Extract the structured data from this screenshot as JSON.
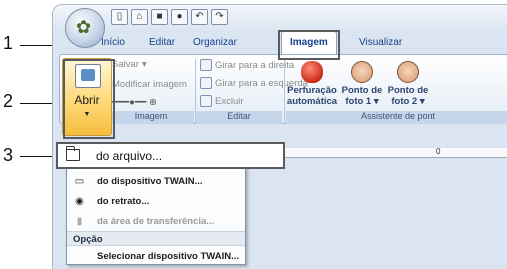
{
  "callouts": [
    "1",
    "2",
    "3"
  ],
  "quick_access": [
    "new-doc-icon",
    "open-icon",
    "save-icon",
    "record-icon",
    "undo-icon",
    "redo-icon"
  ],
  "tabs": {
    "inicio": "Início",
    "editar": "Editar",
    "organizar": "Organizar",
    "imagem": "Imagem",
    "visualizar": "Visualizar"
  },
  "ribbon": {
    "abrir": "Abrir",
    "salvar": "Salvar",
    "modificar_imagem": "Modificar imagem",
    "girar_direita": "Girar para a direita",
    "girar_esquerda": "Girar para a esquerda",
    "excluir": "Excluir",
    "group_imagem": "Imagem",
    "group_editar": "Editar",
    "perfuracao": "Perfuração",
    "automatica": "automática",
    "ponto_de_1": "Ponto de",
    "foto1": "foto 1",
    "ponto_de_2": "Ponto de",
    "foto2": "foto 2",
    "group_assistente": "Assistente de pont"
  },
  "ruler": {
    "zero": "0"
  },
  "menu": {
    "do_arquivo": "do arquivo...",
    "twain": "do dispositivo TWAIN...",
    "retrato": "do retrato...",
    "transferencia": "da área de transferência...",
    "opcao": "Opção",
    "selecionar_twain": "Selecionar dispositivo TWAIN..."
  },
  "colors": {
    "ribbon_bg": "#dbe5f1",
    "highlight_border": "#5a5a5a",
    "button_active": "#ffd979"
  }
}
